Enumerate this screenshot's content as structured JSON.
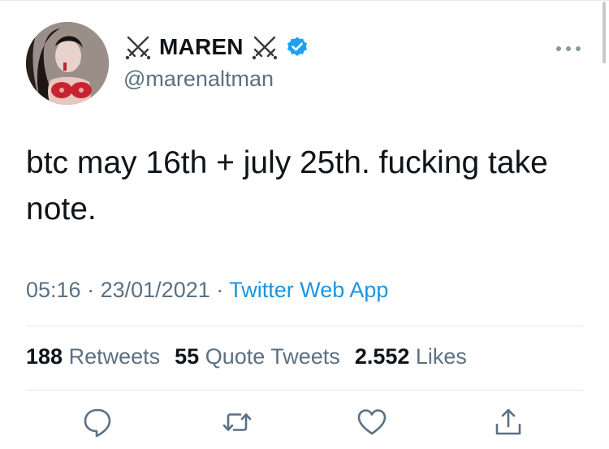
{
  "tweet": {
    "display_name": "MAREN",
    "name_decoration_icon": "crossed-swords-icon",
    "verified_icon": "verified-badge-icon",
    "handle": "@marenaltman",
    "text": "btc may 16th + july 25th. fucking take note.",
    "time": "05:16",
    "date": "23/01/2021",
    "separator": "·",
    "source": "Twitter Web App",
    "colors": {
      "text": "#0f1419",
      "secondary": "#5b7083",
      "link": "#1b95e0",
      "verified": "#1da1f2"
    }
  },
  "stats": {
    "retweets_count": "188",
    "retweets_label": "Retweets",
    "quote_tweets_count": "55",
    "quote_tweets_label": "Quote Tweets",
    "likes_count": "2.552",
    "likes_label": "Likes"
  },
  "actions": {
    "reply_icon": "reply-icon",
    "retweet_icon": "retweet-icon",
    "like_icon": "heart-icon",
    "share_icon": "share-icon",
    "more_icon": "more-dots-icon"
  }
}
